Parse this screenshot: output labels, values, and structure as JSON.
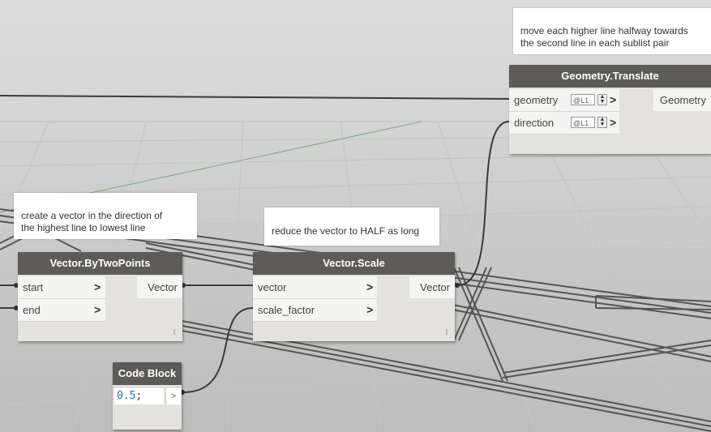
{
  "notes": {
    "translate_note": "move each higher line halfway towards\nthe second line in each sublist pair",
    "vector_note": "create a vector in the direction of\nthe highest line to lowest line",
    "scale_note": "reduce the vector to HALF as long"
  },
  "nodes": {
    "translate": {
      "title": "Geometry.Translate",
      "inputs": [
        "geometry",
        "direction"
      ],
      "lacing": [
        "@L1",
        "@L1"
      ],
      "output": "Geometry"
    },
    "by_two_points": {
      "title": "Vector.ByTwoPoints",
      "inputs": [
        "start",
        "end"
      ],
      "output": "Vector",
      "lacing_mark": "l"
    },
    "scale": {
      "title": "Vector.Scale",
      "inputs": [
        "vector",
        "scale_factor"
      ],
      "output": "Vector",
      "lacing_mark": "l"
    },
    "code_block": {
      "title": "Code Block",
      "code_number": "0.5",
      "code_semicolon": ";",
      "output_glyph": ">"
    }
  },
  "colors": {
    "node_header": "#5d5b57",
    "node_body": "#e3e2dd",
    "wire": "#3a3a3a",
    "code_number": "#2b6fd6"
  },
  "icons": {
    "port_chevron": "chevron-right-icon",
    "lacing_spinner": "spinner-icon"
  }
}
